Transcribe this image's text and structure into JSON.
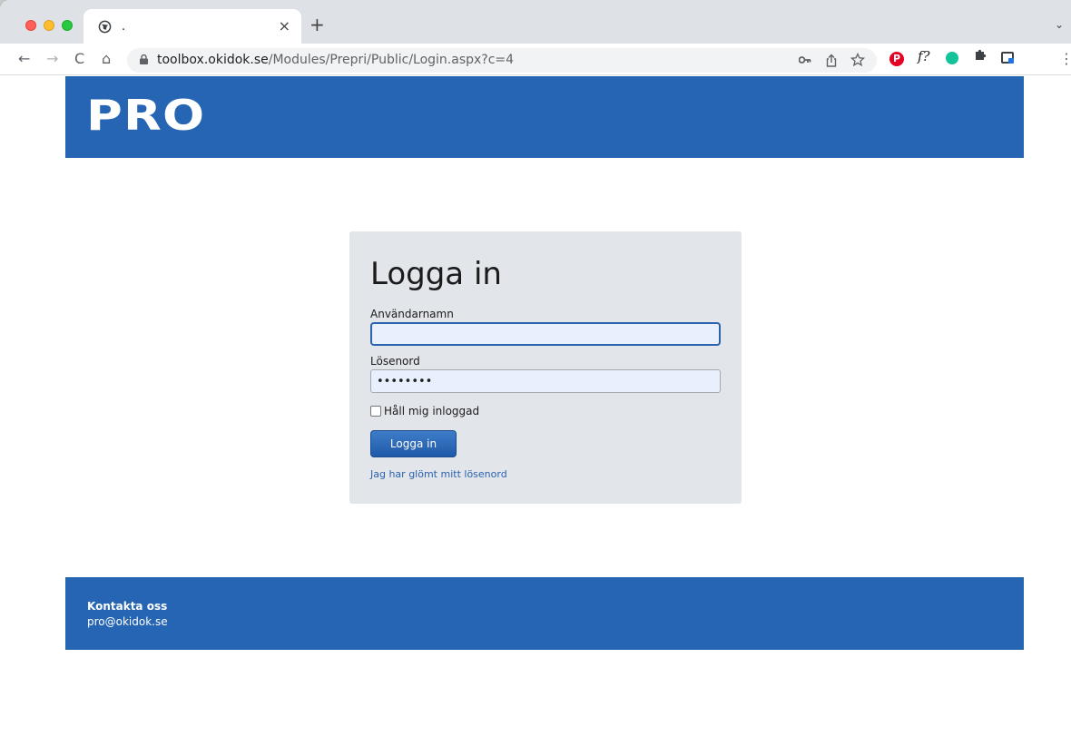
{
  "browser": {
    "tab": {
      "title": ".",
      "close_label": "×"
    },
    "new_tab_label": "+",
    "tab_menu_label": "⌄",
    "nav": {
      "back": "←",
      "forward": "→",
      "reload": "C",
      "home": "⌂"
    },
    "url_domain": "toolbox.okidok.se",
    "url_path": "/Modules/Prepri/Public/Login.aspx?c=4",
    "omnibox_icons": [
      "key-icon",
      "share-icon",
      "bookmark-star-icon"
    ],
    "extensions": [
      "pinterest-icon",
      "font-identify-icon",
      "grammarly-icon",
      "extensions-puzzle-icon",
      "side-panel-icon"
    ],
    "extension_text": {
      "pinterest": "P",
      "font": "f?"
    },
    "menu_label": "⋮"
  },
  "header": {
    "logo_text": "PRO",
    "brand_color": "#2565b4"
  },
  "login": {
    "title": "Logga in",
    "username_label": "Användarnamn",
    "username_value": "",
    "password_label": "Lösenord",
    "password_value": "••••••••",
    "remember_label": "Håll mig inloggad",
    "remember_checked": false,
    "submit_label": "Logga in",
    "forgot_link": "Jag har glömt mitt lösenord"
  },
  "footer": {
    "contact_title": "Kontakta oss",
    "contact_email": "pro@okidok.se"
  }
}
